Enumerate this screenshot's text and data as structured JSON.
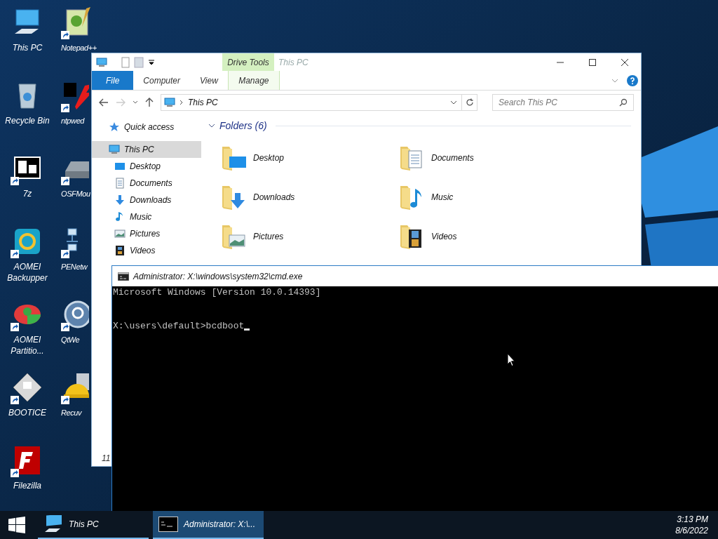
{
  "desktop_icon_columns": [
    [
      {
        "label": "This PC",
        "shortcut": false
      },
      {
        "label": "Recycle Bin",
        "shortcut": false
      },
      {
        "label": "7z",
        "shortcut": true
      },
      {
        "label": "AOMEI Backupper",
        "shortcut": true
      },
      {
        "label": "AOMEI Partitio...",
        "shortcut": true
      },
      {
        "label": "BOOTICE",
        "shortcut": true
      },
      {
        "label": "Filezilla",
        "shortcut": true
      }
    ],
    [
      {
        "label": "Notepad++",
        "shortcut": true
      },
      {
        "label": "ntpwed",
        "shortcut": true
      },
      {
        "label": "OSFMou",
        "shortcut": true
      },
      {
        "label": "PENetw",
        "shortcut": true
      },
      {
        "label": "QtWe",
        "shortcut": true
      },
      {
        "label": "Recuv",
        "shortcut": true
      }
    ]
  ],
  "explorer": {
    "title": "This PC",
    "context_group": "Drive Tools",
    "ribbon_tabs": [
      {
        "label": "File",
        "kind": "file"
      },
      {
        "label": "Computer",
        "kind": "tab"
      },
      {
        "label": "View",
        "kind": "tab"
      },
      {
        "label": "Manage",
        "kind": "contextual"
      }
    ],
    "address": "This PC",
    "search": {
      "placeholder": "Search This PC"
    },
    "nav": [
      {
        "label": "Quick access",
        "selected": false
      },
      {
        "label": "This PC",
        "selected": true,
        "children": [
          {
            "label": "Desktop",
            "selected": false
          },
          {
            "label": "Documents",
            "selected": false
          },
          {
            "label": "Downloads",
            "selected": false
          },
          {
            "label": "Music",
            "selected": false
          },
          {
            "label": "Pictures",
            "selected": false
          },
          {
            "label": "Videos",
            "selected": false
          }
        ]
      }
    ],
    "section": "Folders (6)",
    "folders": [
      {
        "label": "Desktop"
      },
      {
        "label": "Documents"
      },
      {
        "label": "Downloads"
      },
      {
        "label": "Music"
      },
      {
        "label": "Pictures"
      },
      {
        "label": "Videos"
      }
    ],
    "status_bar": "11"
  },
  "cmd": {
    "title": "Administrator: X:\\windows\\system32\\cmd.exe",
    "lines": [
      {
        "text": "Microsoft Windows [Version 10.0.14393]",
        "cursor": false
      },
      {
        "text": "X:\\users\\default>bcdboot",
        "blank_before": true,
        "cursor": true
      }
    ]
  },
  "taskbar": {
    "items": [
      {
        "label": "This PC",
        "selected": false
      },
      {
        "label": "Administrator: X:\\...",
        "selected": true
      }
    ],
    "time": "3:13 PM",
    "date": "8/6/2022"
  }
}
